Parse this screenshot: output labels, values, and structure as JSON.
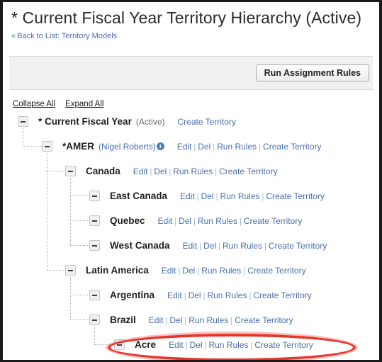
{
  "header": {
    "title": "* Current Fiscal Year Territory Hierarchy (Active)",
    "breadcrumb_chevron": "«",
    "breadcrumb_link": "Back to List: Territory Models"
  },
  "toolbar": {
    "run_assignment_rules_label": "Run Assignment Rules"
  },
  "tree_controls": {
    "collapse_all": "Collapse All",
    "expand_all": "Expand All"
  },
  "colors": {
    "link_blue": "#4a6fa8",
    "annotation_red": "#e8342a",
    "toolbar_gray": "#f1f1f1",
    "info_icon_blue": "#4a7fc1"
  },
  "actions": {
    "edit": "Edit",
    "del": "Del",
    "run_rules": "Run Rules",
    "create_territory": "Create Territory",
    "separator": "|"
  },
  "tree": {
    "rows": [
      {
        "name": "* Current Fiscal Year",
        "status": "(Active)",
        "owner": "",
        "info_icon": false,
        "level": 0,
        "actions": [
          "Create Territory"
        ],
        "highlighted": false
      },
      {
        "name": "*AMER",
        "status": "",
        "owner": "(Nigel Roberts)",
        "info_icon": true,
        "level": 1,
        "actions": [
          "Edit",
          "Del",
          "Run Rules",
          "Create Territory"
        ],
        "highlighted": false
      },
      {
        "name": "Canada",
        "status": "",
        "owner": "",
        "info_icon": false,
        "level": 2,
        "actions": [
          "Edit",
          "Del",
          "Run Rules",
          "Create Territory"
        ],
        "highlighted": false
      },
      {
        "name": "East Canada",
        "status": "",
        "owner": "",
        "info_icon": false,
        "level": 3,
        "actions": [
          "Edit",
          "Del",
          "Run Rules",
          "Create Territory"
        ],
        "highlighted": false
      },
      {
        "name": "Quebec",
        "status": "",
        "owner": "",
        "info_icon": false,
        "level": 3,
        "actions": [
          "Edit",
          "Del",
          "Run Rules",
          "Create Territory"
        ],
        "highlighted": false
      },
      {
        "name": "West Canada",
        "status": "",
        "owner": "",
        "info_icon": false,
        "level": 3,
        "actions": [
          "Edit",
          "Del",
          "Run Rules",
          "Create Territory"
        ],
        "highlighted": false
      },
      {
        "name": "Latin America",
        "status": "",
        "owner": "",
        "info_icon": false,
        "level": 2,
        "actions": [
          "Edit",
          "Del",
          "Run Rules",
          "Create Territory"
        ],
        "highlighted": false
      },
      {
        "name": "Argentina",
        "status": "",
        "owner": "",
        "info_icon": false,
        "level": 3,
        "actions": [
          "Edit",
          "Del",
          "Run Rules",
          "Create Territory"
        ],
        "highlighted": false
      },
      {
        "name": "Brazil",
        "status": "",
        "owner": "",
        "info_icon": false,
        "level": 3,
        "actions": [
          "Edit",
          "Del",
          "Run Rules",
          "Create Territory"
        ],
        "highlighted": false
      },
      {
        "name": "Acre",
        "status": "",
        "owner": "",
        "info_icon": false,
        "level": 4,
        "actions": [
          "Edit",
          "Del",
          "Run Rules",
          "Create Territory"
        ],
        "highlighted": true
      }
    ]
  }
}
